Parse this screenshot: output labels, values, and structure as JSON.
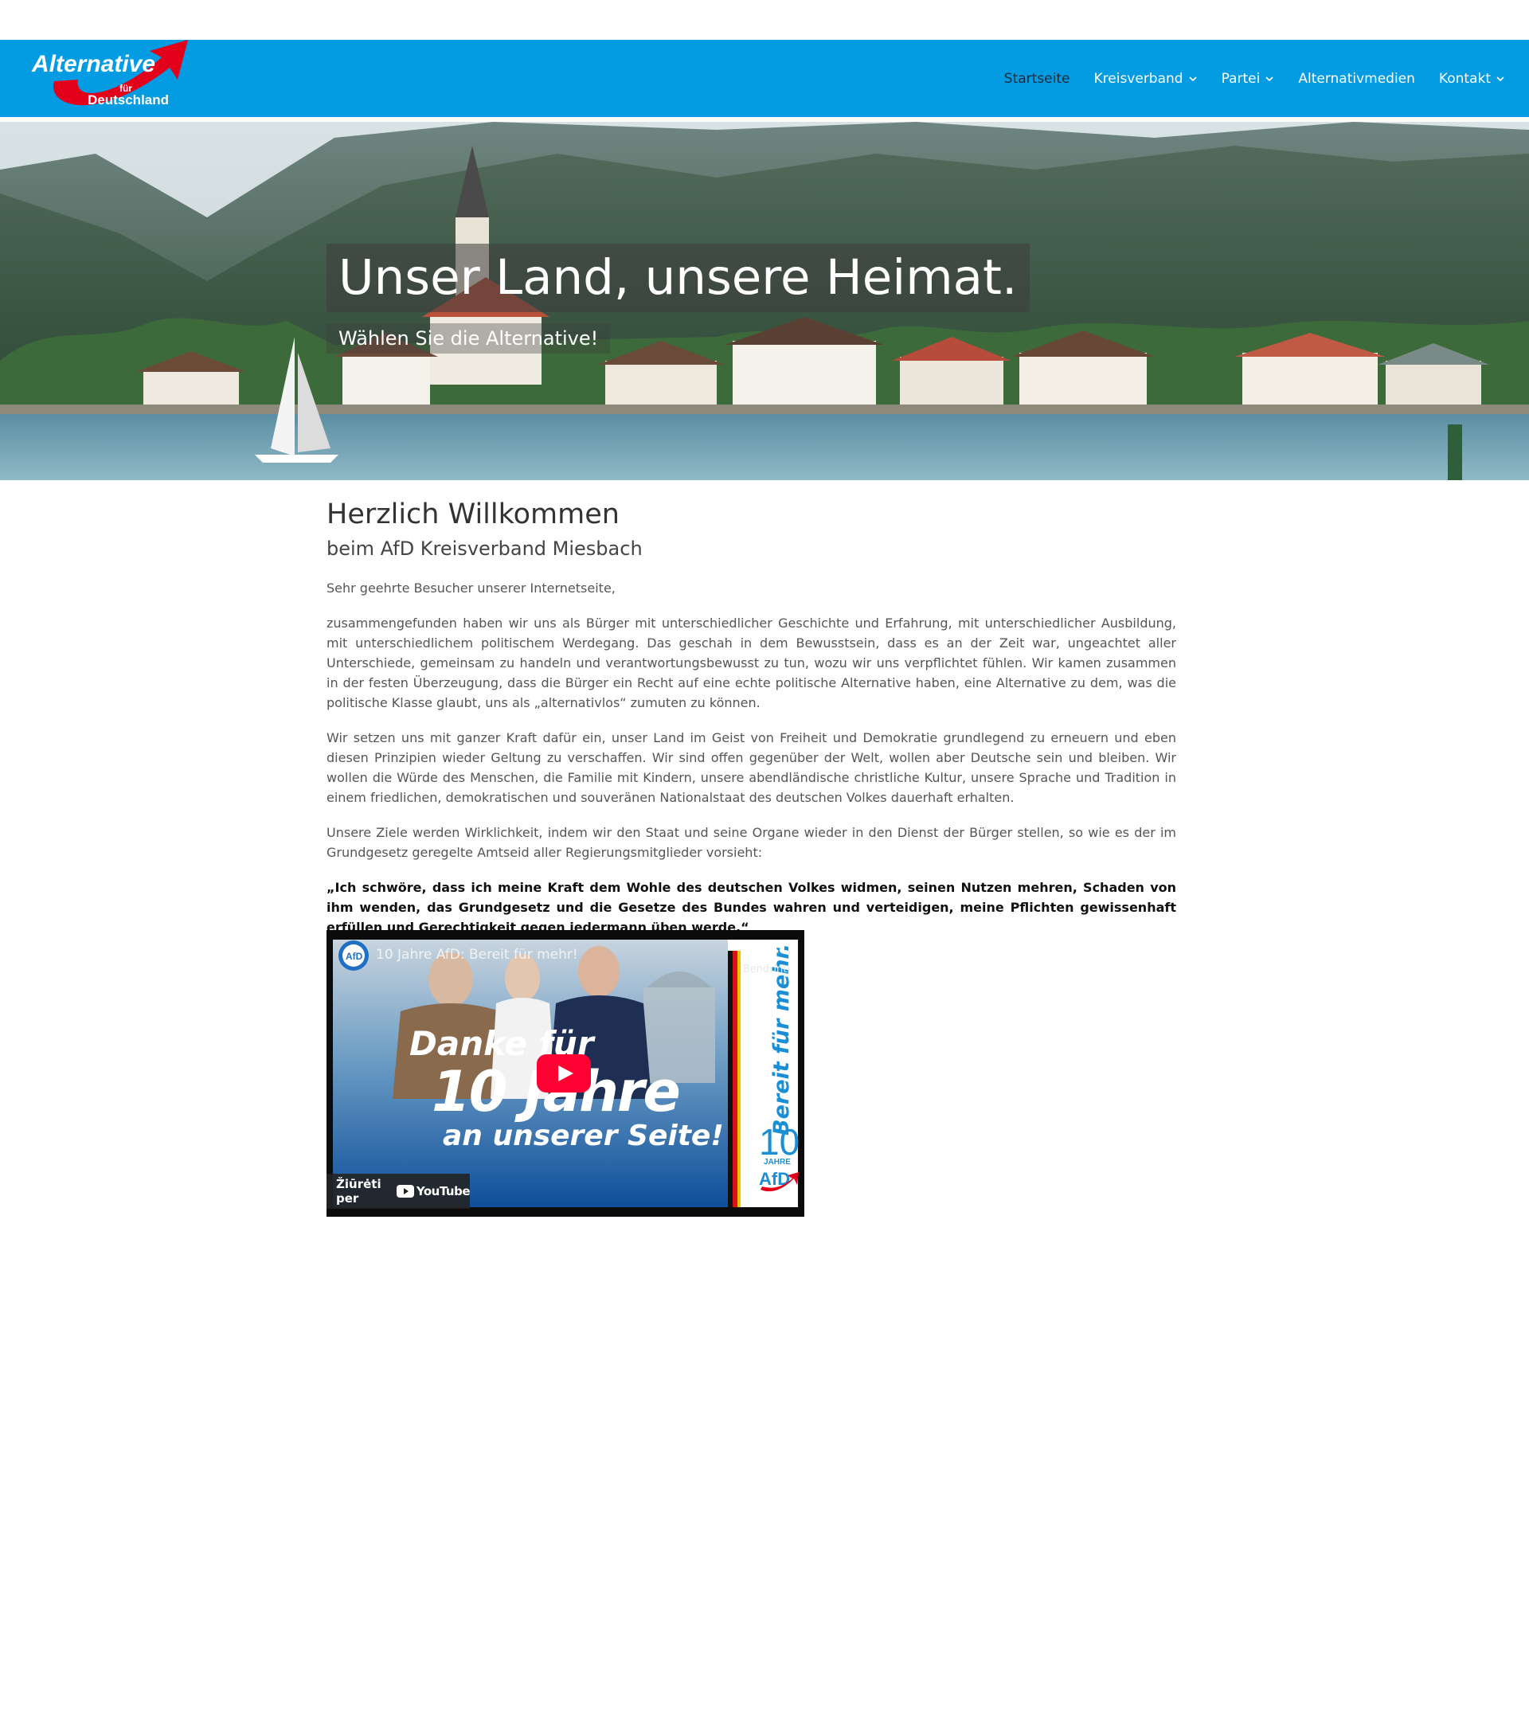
{
  "header": {
    "logo": {
      "line1": "Alternative",
      "line2": "für",
      "line3": "Deutschland"
    },
    "nav": [
      {
        "label": "Startseite",
        "has_dropdown": false,
        "active": true
      },
      {
        "label": "Kreisverband",
        "has_dropdown": true,
        "active": false
      },
      {
        "label": "Partei",
        "has_dropdown": true,
        "active": false
      },
      {
        "label": "Alternativmedien",
        "has_dropdown": false,
        "active": false
      },
      {
        "label": "Kontakt",
        "has_dropdown": true,
        "active": false
      }
    ]
  },
  "hero": {
    "title": "Unser Land, unsere Heimat.",
    "subtitle": "Wählen Sie die Alternative!"
  },
  "content": {
    "heading": "Herzlich Willkommen",
    "subheading": "beim AfD Kreisverband Miesbach",
    "salutation": "Sehr geehrte Besucher unserer Internetseite,",
    "paragraphs": [
      "zusammengefunden haben wir uns als Bürger mit unterschiedlicher Geschichte und Erfahrung, mit unterschiedlicher Ausbildung, mit unterschiedlichem politischem Werdegang. Das geschah in dem Bewusstsein, dass es an der Zeit war, ungeachtet aller Unterschiede, gemeinsam zu handeln und verantwortungsbewusst zu tun, wozu wir uns verpflichtet fühlen. Wir kamen zusammen in der festen Überzeugung, dass die Bürger ein Recht auf eine echte politische Alternative haben, eine Alternative zu dem, was die politische Klasse glaubt, uns als „alternativlos“ zumuten zu können.",
      "Wir setzen uns mit ganzer Kraft dafür ein, unser Land im Geist von Freiheit und Demokratie grundlegend zu erneuern und eben diesen Prinzipien wieder Geltung zu verschaffen. Wir sind offen gegenüber der Welt, wollen aber Deutsche sein und bleiben. Wir wollen die Würde des Menschen, die Familie mit Kindern, unsere abendländische christliche Kultur, unsere Sprache und Tradition in einem friedlichen, demokratischen und souveränen Nationalstaat des deutschen Volkes dauerhaft erhalten.",
      "Unsere Ziele werden Wirklichkeit, indem wir den Staat und seine Organe wieder in den Dienst der Bürger stellen, so wie es der im Grundgesetz geregelte Amtseid aller Regierungsmitglieder vorsieht:"
    ],
    "quote": "„Ich schwöre, dass ich meine Kraft dem Wohle des deutschen Volkes widmen, seinen Nutzen mehren, Schaden von ihm wenden, das Grundgesetz und die Gesetze des Bundes wahren und verteidigen, meine Pflichten gewissenhaft erfüllen und Gerechtigkeit gegen jedermann üben werde.“"
  },
  "video": {
    "title": "10 Jahre AfD: Bereit für mehr!",
    "channel_badge": "AfD",
    "share_label": "Bendrinti",
    "watch_on": "Žiūrėti per",
    "youtube": "YouTube",
    "thumb_line1": "Danke für",
    "thumb_line2": "10 Jahre",
    "thumb_line3": "an unserer Seite!",
    "side_text": "Bereit für mehr.",
    "badge_number": "10",
    "badge_word": "JAHRE",
    "badge_party": "AfD"
  },
  "colors": {
    "header_blue": "#039be2",
    "logo_red": "#e3001b",
    "youtube_red": "#ff0033"
  },
  "icons": [
    "chevron-down-icon",
    "play-icon",
    "share-icon",
    "youtube-icon"
  ]
}
